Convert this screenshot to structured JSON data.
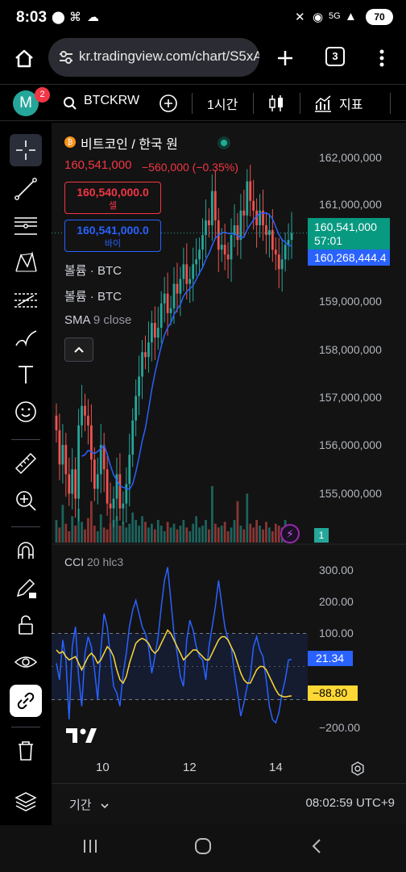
{
  "status_bar": {
    "time": "8:03",
    "battery": "70"
  },
  "browser": {
    "url": "kr.tradingview.com/chart/S5xA",
    "tab_count": "3"
  },
  "toolbar": {
    "avatar_letter": "M",
    "notification_count": "2",
    "symbol": "BTCKRW",
    "interval": "1시간",
    "indicators_label": "지표"
  },
  "legend": {
    "title": "비트코인 / 한국 원",
    "last_price": "160,541,000",
    "change": "−560,000 (−0.35%)",
    "sell_price": "160,540,000.0",
    "sell_label": "셀",
    "buy_price": "160,541,000.0",
    "buy_label": "바이",
    "indicator1_name": "볼륨",
    "indicator1_sym": "· BTC",
    "indicator2_name": "볼륨",
    "indicator2_sym": "· BTC",
    "sma_name": "SMA",
    "sma_params": "9 close"
  },
  "price_axis": {
    "labels": [
      "162,000,000",
      "161,000,000",
      "159,000,000",
      "158,000,000",
      "157,000,000",
      "156,000,000",
      "155,000,000"
    ],
    "current_price": "160,541,000",
    "countdown": "57:01",
    "sma_value": "160,268,444.4",
    "volume_badge": "1"
  },
  "cci": {
    "name": "CCI",
    "params": "20 hlc3",
    "axis_labels": [
      "300.00",
      "200.00",
      "100.00",
      "−200.00"
    ],
    "value": "21.34",
    "signal_value": "−88.80"
  },
  "time_axis": {
    "labels": [
      "10",
      "12",
      "14"
    ]
  },
  "bottom": {
    "period_label": "기간",
    "clock": "08:02:59 UTC+9"
  },
  "colors": {
    "up": "#26a69a",
    "down": "#ef5350",
    "sma": "#2962ff",
    "cci_line": "#2962ff",
    "cci_signal": "#fdd835",
    "background": "#131313"
  },
  "chart_data": {
    "type": "candlestick",
    "price_range": [
      154200000,
      162800000
    ],
    "sma_period": 9,
    "closes": [
      156500000,
      155800000,
      156200000,
      155600000,
      155200000,
      155700000,
      155100000,
      156600000,
      157000000,
      156800000,
      156600000,
      155900000,
      155300000,
      155600000,
      156200000,
      155700000,
      155000000,
      154900000,
      155100000,
      155600000,
      154900000,
      155000000,
      155400000,
      156000000,
      156700000,
      157200000,
      157600000,
      158100000,
      158000000,
      158300000,
      158700000,
      158400000,
      158600000,
      159100000,
      159300000,
      158900000,
      159000000,
      159500000,
      159300000,
      159600000,
      159900000,
      159500000,
      159600000,
      159900000,
      160000000,
      160200000,
      160500000,
      160800000,
      160700000,
      161400000,
      160800000,
      160200000,
      160300000,
      160100000,
      160000000,
      160500000,
      160700000,
      160400000,
      161000000,
      160900000,
      161600000,
      161200000,
      161000000,
      160700000,
      161000000,
      160700000,
      160500000,
      160600000,
      160200000,
      160100000,
      159800000,
      160000000,
      160300000,
      160400000,
      160541000
    ],
    "volumes": [
      12,
      8,
      20,
      10,
      6,
      14,
      9,
      18,
      11,
      7,
      13,
      22,
      9,
      6,
      15,
      8,
      7,
      10,
      12,
      14,
      9,
      11,
      8,
      10,
      16,
      12,
      9,
      14,
      11,
      8,
      10,
      7,
      12,
      9,
      6,
      11,
      8,
      10,
      7,
      9,
      12,
      8,
      6,
      10,
      14,
      8,
      9,
      12,
      7,
      30,
      10,
      8,
      9,
      11,
      6,
      8,
      12,
      22,
      9,
      7,
      26,
      10,
      8,
      12,
      9,
      7,
      11,
      8,
      6,
      10,
      9,
      8,
      12,
      7,
      5
    ],
    "cci": [
      10,
      -40,
      80,
      20,
      -160,
      60,
      120,
      -30,
      -120,
      40,
      90,
      60,
      -10,
      -100,
      50,
      160,
      120,
      30,
      -60,
      -80,
      -120,
      -20,
      40,
      120,
      170,
      200,
      160,
      120,
      100,
      60,
      -20,
      30,
      90,
      180,
      260,
      300,
      200,
      100,
      40,
      -30,
      -60,
      80,
      140,
      110,
      60,
      30,
      20,
      -40,
      60,
      120,
      180,
      260,
      190,
      120,
      80,
      60,
      -20,
      -80,
      -150,
      -110,
      -60,
      -30,
      60,
      90,
      50,
      30,
      -40,
      -120,
      -160,
      -170,
      -140,
      -80,
      -40,
      20,
      21.34
    ],
    "cci_signal": [
      50,
      40,
      45,
      30,
      20,
      25,
      30,
      10,
      -10,
      10,
      30,
      40,
      30,
      10,
      20,
      40,
      60,
      50,
      30,
      -10,
      -40,
      -50,
      -30,
      10,
      40,
      70,
      80,
      85,
      80,
      70,
      50,
      40,
      50,
      70,
      90,
      110,
      100,
      80,
      60,
      40,
      20,
      30,
      40,
      50,
      50,
      40,
      30,
      20,
      20,
      40,
      60,
      80,
      90,
      90,
      80,
      60,
      40,
      10,
      -20,
      -40,
      -50,
      -50,
      -30,
      -10,
      0,
      0,
      -10,
      -30,
      -50,
      -70,
      -85,
      -90,
      -92,
      -90,
      -88.8
    ],
    "cci_range": [
      -250,
      350
    ],
    "cci_bands": [
      100,
      -100
    ]
  }
}
